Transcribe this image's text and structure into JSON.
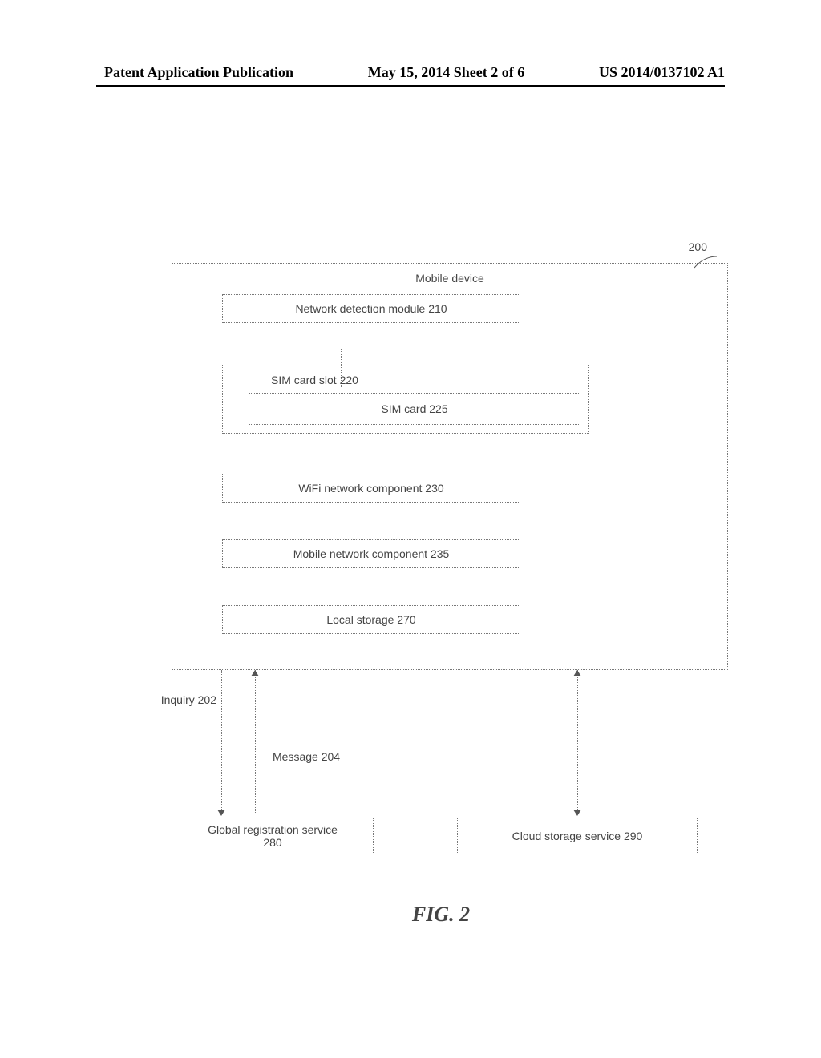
{
  "header": {
    "left": "Patent Application Publication",
    "center": "May 15, 2014  Sheet 2 of 6",
    "right": "US 2014/0137102 A1"
  },
  "ref_number": "200",
  "mobile_device": {
    "title": "Mobile device",
    "network_detection": "Network detection module 210",
    "sim_slot": "SIM card slot 220",
    "sim_card": "SIM card 225",
    "wifi": "WiFi network component 230",
    "mobile_network": "Mobile network component 235",
    "local_storage": "Local storage 270"
  },
  "arrows": {
    "inquiry": "Inquiry 202",
    "message": "Message 204"
  },
  "external": {
    "global_registration_line1": "Global registration service",
    "global_registration_line2": "280",
    "cloud_storage": "Cloud storage service 290"
  },
  "figure_label": "FIG. 2"
}
